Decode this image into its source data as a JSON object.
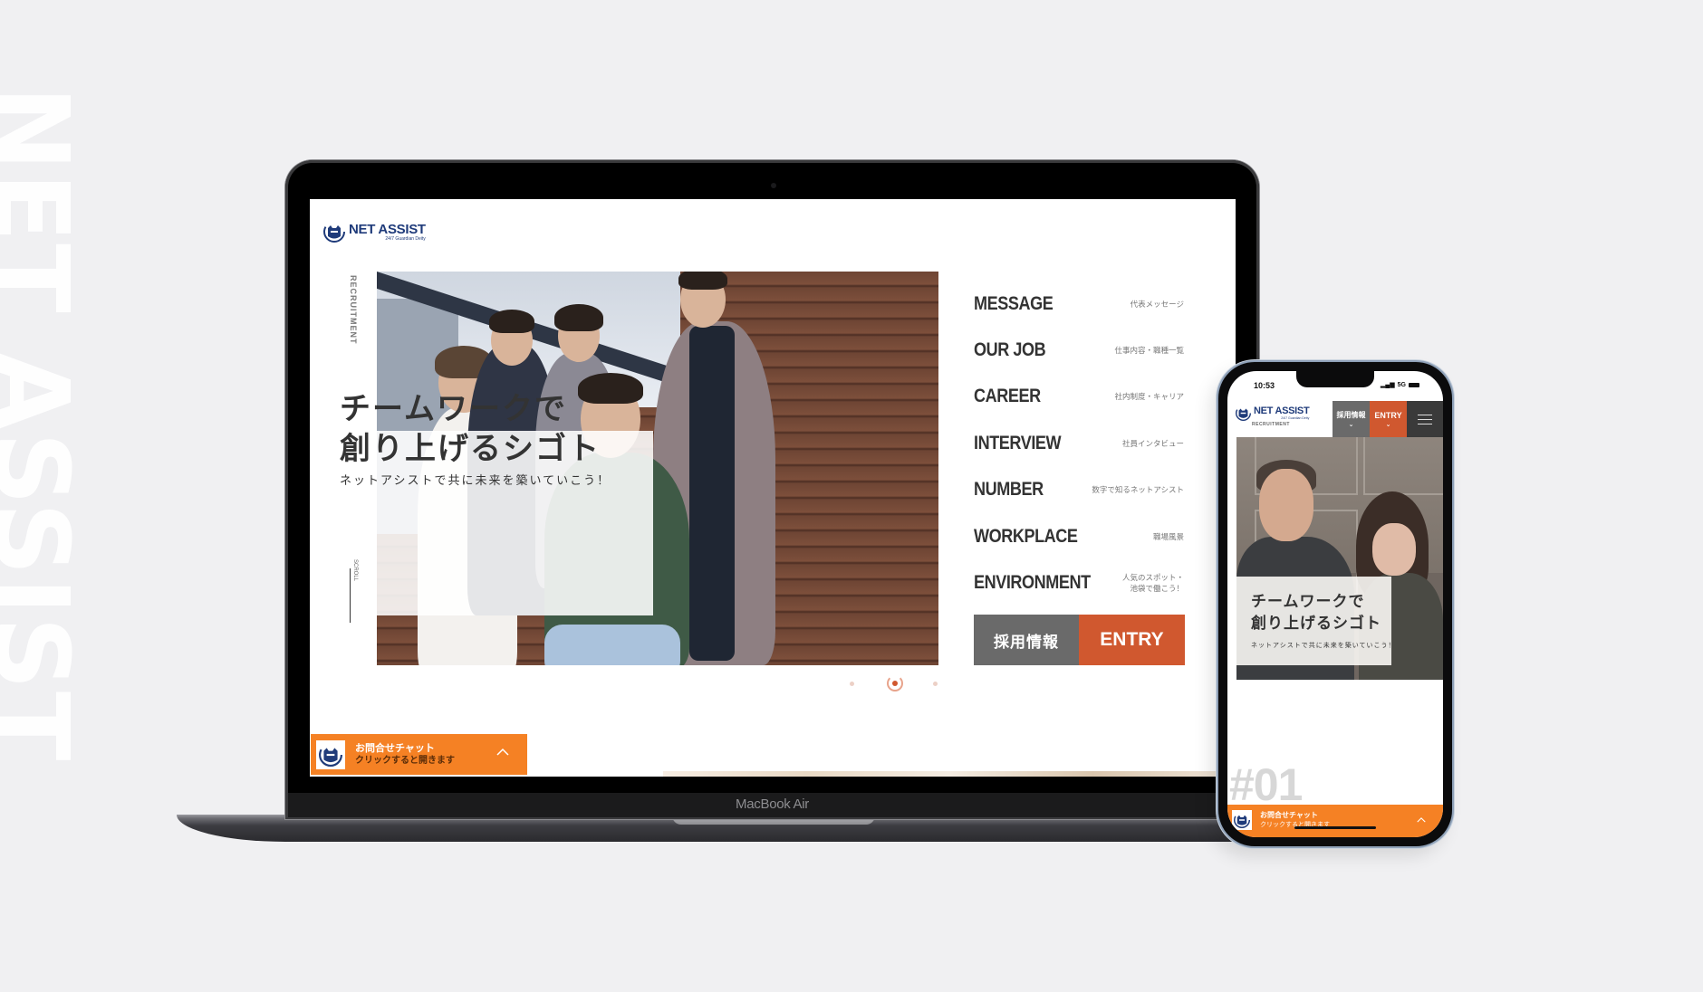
{
  "background_text": "NET ASSIST",
  "laptop": {
    "model_label": "MacBook Air",
    "site": {
      "logo": {
        "name": "NET ASSIST",
        "tagline": "24/7 Guardian Deity",
        "icon": "cat-logo-icon"
      },
      "side_label": "RECRUITMENT",
      "hero": {
        "title_line1": "チームワークで",
        "title_line2": "創り上げるシゴト",
        "subtitle": "ネットアシストで共に未来を築いていこう！"
      },
      "scroll_label": "SCROLL",
      "menu": [
        {
          "en": "MESSAGE",
          "jp": "代表メッセージ"
        },
        {
          "en": "OUR JOB",
          "jp": "仕事内容・職種一覧"
        },
        {
          "en": "CAREER",
          "jp": "社内制度・キャリア"
        },
        {
          "en": "INTERVIEW",
          "jp": "社員インタビュー"
        },
        {
          "en": "NUMBER",
          "jp": "数字で知るネットアシスト"
        },
        {
          "en": "WORKPLACE",
          "jp": "職場風景"
        },
        {
          "en": "ENVIRONMENT",
          "jp": "人気のスポット・\n池袋で働こう！"
        }
      ],
      "buttons": {
        "recruit": "採用情報",
        "entry": "ENTRY"
      },
      "slider": {
        "total": 3,
        "active": 2
      },
      "chat": {
        "title": "お問合せチャット",
        "subtitle": "クリックすると開きます"
      }
    }
  },
  "phone": {
    "status": {
      "time": "10:53",
      "network": "5G"
    },
    "site": {
      "logo": {
        "name": "NET ASSIST",
        "tagline": "24/7 Guardian Deity"
      },
      "label": "RECRUITMENT",
      "buttons": {
        "recruit": "採用情報",
        "entry": "ENTRY"
      },
      "hero": {
        "title_line1": "チームワークで",
        "title_line2": "創り上げるシゴト",
        "subtitle": "ネットアシストで共に未来を築いていこう！"
      },
      "section_number": "#01",
      "chat": {
        "title": "お問合せチャット",
        "subtitle": "クリックすると開きます"
      }
    }
  },
  "colors": {
    "brand_navy": "#1f3b7a",
    "accent_orange": "#d0582f",
    "chat_orange": "#f58124",
    "button_gray": "#6a6a6a",
    "page_bg": "#f0f0f2"
  }
}
